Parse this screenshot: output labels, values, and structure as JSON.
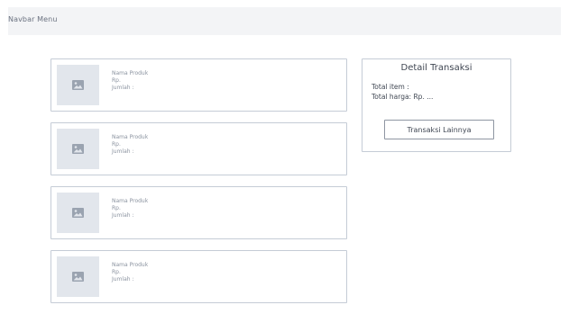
{
  "navbar": {
    "title": "Navbar Menu"
  },
  "products": [
    {
      "name": "Nama Produk",
      "price": "Rp.",
      "quantity": "Jumlah :"
    },
    {
      "name": "Nama Produk",
      "price": "Rp.",
      "quantity": "Jumlah :"
    },
    {
      "name": "Nama Produk",
      "price": "Rp.",
      "quantity": "Jumlah :"
    },
    {
      "name": "Nama Produk",
      "price": "Rp.",
      "quantity": "Jumlah :"
    }
  ],
  "product_thumb_icon": "image-placeholder-icon",
  "detail": {
    "title": "Detail Transaksi",
    "total_items": "Total item :",
    "total_price": "Total harga: Rp. ...",
    "button_label": "Transaksi Lainnya"
  },
  "colors": {
    "navbar_bg": "#f3f4f6",
    "border": "#c5ccd6",
    "thumb_bg": "#e2e6ec",
    "icon": "#9aa3b0"
  }
}
